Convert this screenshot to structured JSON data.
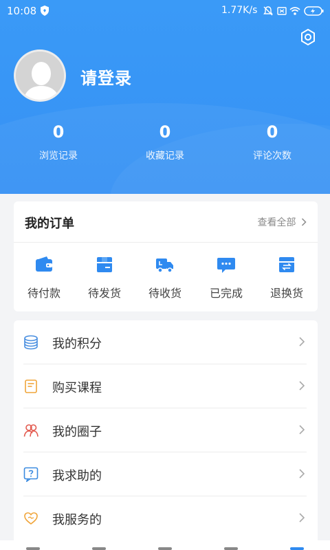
{
  "status_bar": {
    "time": "10:08",
    "network_speed": "1.77K/s"
  },
  "profile": {
    "login_prompt": "请登录"
  },
  "stats": [
    {
      "value": "0",
      "label": "浏览记录"
    },
    {
      "value": "0",
      "label": "收藏记录"
    },
    {
      "value": "0",
      "label": "评论次数"
    }
  ],
  "orders": {
    "title": "我的订单",
    "view_all": "查看全部",
    "items": [
      {
        "label": "待付款",
        "icon": "wallet-icon"
      },
      {
        "label": "待发货",
        "icon": "box-icon"
      },
      {
        "label": "待收货",
        "icon": "truck-icon"
      },
      {
        "label": "已完成",
        "icon": "chat-icon"
      },
      {
        "label": "退换货",
        "icon": "exchange-icon"
      }
    ]
  },
  "menu": [
    {
      "label": "我的积分",
      "icon": "coins-icon",
      "color": "#4a8fe0"
    },
    {
      "label": "购买课程",
      "icon": "book-icon",
      "color": "#f0a53a"
    },
    {
      "label": "我的圈子",
      "icon": "people-icon",
      "color": "#e35a4f"
    },
    {
      "label": "我求助的",
      "icon": "question-icon",
      "color": "#3a8ae0"
    },
    {
      "label": "我服务的",
      "icon": "heart-icon",
      "color": "#f0a53a"
    }
  ],
  "colors": {
    "header_blue": "#3691f4",
    "accent_blue": "#2f8af0",
    "background": "#f3f4f6"
  }
}
